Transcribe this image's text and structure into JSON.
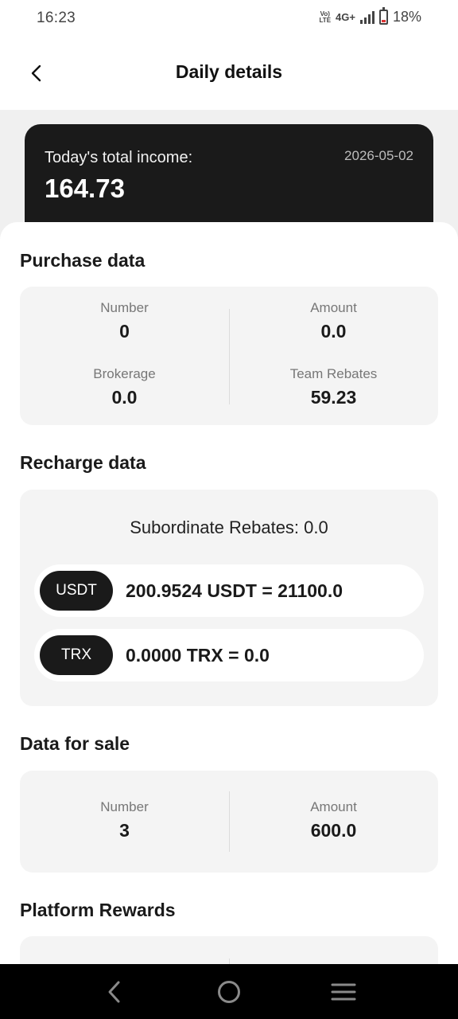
{
  "status_bar": {
    "time": "16:23",
    "volte_line1": "Vo)",
    "volte_line2": "LTE",
    "network": "4G+",
    "battery": "18%",
    "battery_level": 0.18
  },
  "header": {
    "title": "Daily details",
    "back_icon": "chevron-left-icon"
  },
  "income": {
    "label": "Today's total income:",
    "date": "2026-05-02",
    "value": "164.73"
  },
  "purchase": {
    "title": "Purchase data",
    "items": [
      {
        "label": "Number",
        "value": "0"
      },
      {
        "label": "Amount",
        "value": "0.0"
      },
      {
        "label": "Brokerage",
        "value": "0.0"
      },
      {
        "label": "Team Rebates",
        "value": "59.23"
      }
    ]
  },
  "recharge": {
    "title": "Recharge data",
    "subordinate_rebates": "Subordinate Rebates: 0.0",
    "coins": [
      {
        "name": "USDT",
        "text": "200.9524 USDT = 21100.0"
      },
      {
        "name": "TRX",
        "text": "0.0000 TRX = 0.0"
      }
    ]
  },
  "sale": {
    "title": "Data for sale",
    "items": [
      {
        "label": "Number",
        "value": "3"
      },
      {
        "label": "Amount",
        "value": "600.0"
      }
    ]
  },
  "rewards": {
    "title": "Platform Rewards"
  },
  "navbar": {
    "icons": [
      "back-icon",
      "home-icon",
      "menu-icon"
    ]
  },
  "colors": {
    "card_dark": "#1a1a1a",
    "panel_bg": "#f4f4f4",
    "page_bg": "#f0f0f0"
  }
}
